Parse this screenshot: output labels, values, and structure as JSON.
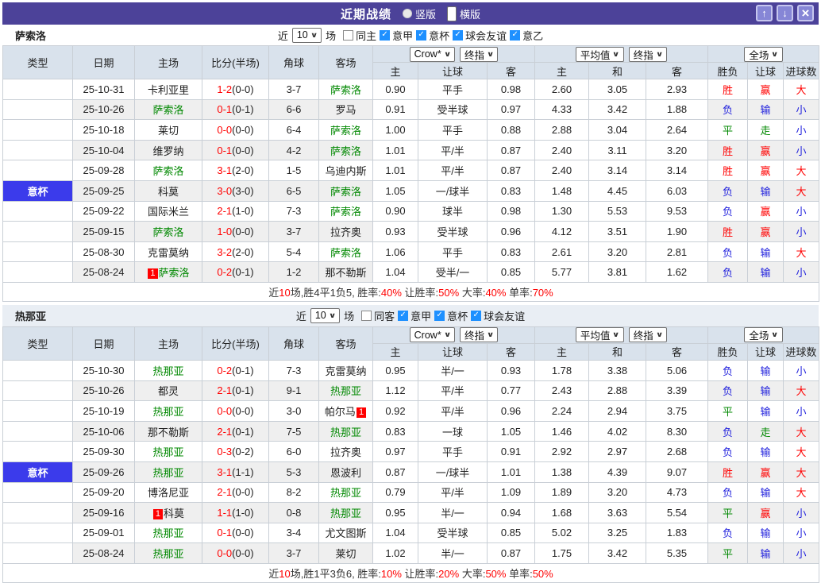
{
  "titlebar": {
    "title": "近期战绩",
    "radios": [
      {
        "label": "竖版",
        "selected": false
      },
      {
        "label": "横版",
        "selected": true
      }
    ],
    "buttons": {
      "up": "↑",
      "down": "↓",
      "close": "×"
    }
  },
  "colors": {
    "titlebar": "#4C4299",
    "button": "#8686D6",
    "buttonborder": "#C6C6EE",
    "league": "#2095FF",
    "cup": "#3B3BEB",
    "headerbg": "#D9E2EC",
    "bandbg": "#E9EEF4",
    "cream": "#FCF6E9",
    "avgblue": "#E7F2F9",
    "stripe": "#EFEFEF",
    "red": "#FF0000",
    "blue": "#2222DD",
    "green": "#008800",
    "teamgreen": "#008800"
  },
  "header": {
    "cols": [
      "类型",
      "日期",
      "主场",
      "比分(半场)",
      "角球",
      "客场"
    ],
    "sel_crow": "Crow*",
    "sel_final1": "终指",
    "sel_avg": "平均值",
    "sel_final2": "终指",
    "sel_full": "全场",
    "g1cols": [
      "主",
      "让球",
      "客"
    ],
    "g2cols": [
      "主",
      "和",
      "客"
    ],
    "g3cols": [
      "胜负",
      "让球",
      "进球数"
    ]
  },
  "sections": [
    {
      "team": "萨索洛",
      "filter": {
        "prefix": "近",
        "count": "10",
        "suffix": "场",
        "checkboxes": [
          {
            "label": "同主",
            "checked": false
          },
          {
            "label": "意甲",
            "checked": true
          },
          {
            "label": "意杯",
            "checked": true
          },
          {
            "label": "球会友谊",
            "checked": true
          },
          {
            "label": "意乙",
            "checked": true
          }
        ]
      },
      "rows": [
        {
          "lg": "意甲",
          "cup": false,
          "date": "25-10-31",
          "home": {
            "n": "卡利亚里"
          },
          "score": [
            "1-2",
            "(0-0)"
          ],
          "cr": "3-7",
          "away": {
            "n": "萨索洛",
            "s": 1
          },
          "o1": [
            "0.90",
            "平手",
            "0.98"
          ],
          "o2": [
            "2.60",
            "3.05",
            "2.93"
          ],
          "res": [
            [
              "胜",
              "r"
            ],
            [
              "赢",
              "r"
            ],
            [
              "大",
              "r"
            ]
          ]
        },
        {
          "lg": "意甲",
          "cup": false,
          "date": "25-10-26",
          "home": {
            "n": "萨索洛",
            "s": 1
          },
          "score": [
            "0-1",
            "(0-1)"
          ],
          "cr": "6-6",
          "away": {
            "n": "罗马"
          },
          "o1": [
            "0.91",
            "受半球",
            "0.97"
          ],
          "o2": [
            "4.33",
            "3.42",
            "1.88"
          ],
          "res": [
            [
              "负",
              "b"
            ],
            [
              "输",
              "b"
            ],
            [
              "小",
              "b"
            ]
          ]
        },
        {
          "lg": "意甲",
          "cup": false,
          "date": "25-10-18",
          "home": {
            "n": "莱切"
          },
          "score": [
            "0-0",
            "(0-0)"
          ],
          "cr": "6-4",
          "away": {
            "n": "萨索洛",
            "s": 1
          },
          "o1": [
            "1.00",
            "平手",
            "0.88"
          ],
          "o2": [
            "2.88",
            "3.04",
            "2.64"
          ],
          "res": [
            [
              "平",
              "g"
            ],
            [
              "走",
              "g"
            ],
            [
              "小",
              "b"
            ]
          ]
        },
        {
          "lg": "意甲",
          "cup": false,
          "date": "25-10-04",
          "home": {
            "n": "维罗纳"
          },
          "score": [
            "0-1",
            "(0-0)"
          ],
          "cr": "4-2",
          "away": {
            "n": "萨索洛",
            "s": 1
          },
          "o1": [
            "1.01",
            "平/半",
            "0.87"
          ],
          "o2": [
            "2.40",
            "3.11",
            "3.20"
          ],
          "res": [
            [
              "胜",
              "r"
            ],
            [
              "赢",
              "r"
            ],
            [
              "小",
              "b"
            ]
          ]
        },
        {
          "lg": "意甲",
          "cup": false,
          "date": "25-09-28",
          "home": {
            "n": "萨索洛",
            "s": 1
          },
          "score": [
            "3-1",
            "(2-0)"
          ],
          "cr": "1-5",
          "away": {
            "n": "乌迪内斯"
          },
          "o1": [
            "1.01",
            "平/半",
            "0.87"
          ],
          "o2": [
            "2.40",
            "3.14",
            "3.14"
          ],
          "res": [
            [
              "胜",
              "r"
            ],
            [
              "赢",
              "r"
            ],
            [
              "大",
              "r"
            ]
          ]
        },
        {
          "lg": "意杯",
          "cup": true,
          "date": "25-09-25",
          "home": {
            "n": "科莫"
          },
          "score": [
            "3-0",
            "(3-0)"
          ],
          "cr": "6-5",
          "away": {
            "n": "萨索洛",
            "s": 1
          },
          "o1": [
            "1.05",
            "一/球半",
            "0.83"
          ],
          "o2": [
            "1.48",
            "4.45",
            "6.03"
          ],
          "res": [
            [
              "负",
              "b"
            ],
            [
              "输",
              "b"
            ],
            [
              "大",
              "r"
            ]
          ]
        },
        {
          "lg": "意甲",
          "cup": false,
          "date": "25-09-22",
          "home": {
            "n": "国际米兰"
          },
          "score": [
            "2-1",
            "(1-0)"
          ],
          "cr": "7-3",
          "away": {
            "n": "萨索洛",
            "s": 1
          },
          "o1": [
            "0.90",
            "球半",
            "0.98"
          ],
          "o2": [
            "1.30",
            "5.53",
            "9.53"
          ],
          "res": [
            [
              "负",
              "b"
            ],
            [
              "赢",
              "r"
            ],
            [
              "小",
              "b"
            ]
          ]
        },
        {
          "lg": "意甲",
          "cup": false,
          "date": "25-09-15",
          "home": {
            "n": "萨索洛",
            "s": 1
          },
          "score": [
            "1-0",
            "(0-0)"
          ],
          "cr": "3-7",
          "away": {
            "n": "拉齐奥"
          },
          "o1": [
            "0.93",
            "受半球",
            "0.96"
          ],
          "o2": [
            "4.12",
            "3.51",
            "1.90"
          ],
          "res": [
            [
              "胜",
              "r"
            ],
            [
              "赢",
              "r"
            ],
            [
              "小",
              "b"
            ]
          ]
        },
        {
          "lg": "意甲",
          "cup": false,
          "date": "25-08-30",
          "home": {
            "n": "克雷莫纳"
          },
          "score": [
            "3-2",
            "(2-0)"
          ],
          "cr": "5-4",
          "away": {
            "n": "萨索洛",
            "s": 1
          },
          "o1": [
            "1.06",
            "平手",
            "0.83"
          ],
          "o2": [
            "2.61",
            "3.20",
            "2.81"
          ],
          "res": [
            [
              "负",
              "b"
            ],
            [
              "输",
              "b"
            ],
            [
              "大",
              "r"
            ]
          ]
        },
        {
          "lg": "意甲",
          "cup": false,
          "date": "25-08-24",
          "home": {
            "n": "萨索洛",
            "s": 1,
            "b": "1",
            "bp": "before"
          },
          "score": [
            "0-2",
            "(0-1)"
          ],
          "cr": "1-2",
          "away": {
            "n": "那不勒斯"
          },
          "o1": [
            "1.04",
            "受半/一",
            "0.85"
          ],
          "o2": [
            "5.77",
            "3.81",
            "1.62"
          ],
          "res": [
            [
              "负",
              "b"
            ],
            [
              "输",
              "b"
            ],
            [
              "小",
              "b"
            ]
          ]
        }
      ],
      "summary": [
        {
          "text": "近"
        },
        {
          "text": "10",
          "red": true
        },
        {
          "text": "场,胜4平1负5, 胜率:"
        },
        {
          "text": "40%",
          "red": true
        },
        {
          "text": " 让胜率:"
        },
        {
          "text": "50%",
          "red": true
        },
        {
          "text": " 大率:"
        },
        {
          "text": "40%",
          "red": true
        },
        {
          "text": " 单率:"
        },
        {
          "text": "70%",
          "red": true
        }
      ]
    },
    {
      "team": "热那亚",
      "filter": {
        "prefix": "近",
        "count": "10",
        "suffix": "场",
        "checkboxes": [
          {
            "label": "同客",
            "checked": false
          },
          {
            "label": "意甲",
            "checked": true
          },
          {
            "label": "意杯",
            "checked": true
          },
          {
            "label": "球会友谊",
            "checked": true
          }
        ]
      },
      "rows": [
        {
          "lg": "意甲",
          "cup": false,
          "date": "25-10-30",
          "home": {
            "n": "热那亚",
            "s": 1
          },
          "score": [
            "0-2",
            "(0-1)"
          ],
          "cr": "7-3",
          "away": {
            "n": "克雷莫纳"
          },
          "o1": [
            "0.95",
            "半/一",
            "0.93"
          ],
          "o2": [
            "1.78",
            "3.38",
            "5.06"
          ],
          "res": [
            [
              "负",
              "b"
            ],
            [
              "输",
              "b"
            ],
            [
              "小",
              "b"
            ]
          ]
        },
        {
          "lg": "意甲",
          "cup": false,
          "date": "25-10-26",
          "home": {
            "n": "都灵"
          },
          "score": [
            "2-1",
            "(0-1)"
          ],
          "cr": "9-1",
          "away": {
            "n": "热那亚",
            "s": 1
          },
          "o1": [
            "1.12",
            "平/半",
            "0.77"
          ],
          "o2": [
            "2.43",
            "2.88",
            "3.39"
          ],
          "res": [
            [
              "负",
              "b"
            ],
            [
              "输",
              "b"
            ],
            [
              "大",
              "r"
            ]
          ]
        },
        {
          "lg": "意甲",
          "cup": false,
          "date": "25-10-19",
          "home": {
            "n": "热那亚",
            "s": 1
          },
          "score": [
            "0-0",
            "(0-0)"
          ],
          "cr": "3-0",
          "away": {
            "n": "帕尔马",
            "b": "1",
            "bp": "after"
          },
          "o1": [
            "0.92",
            "平/半",
            "0.96"
          ],
          "o2": [
            "2.24",
            "2.94",
            "3.75"
          ],
          "res": [
            [
              "平",
              "g"
            ],
            [
              "输",
              "b"
            ],
            [
              "小",
              "b"
            ]
          ]
        },
        {
          "lg": "意甲",
          "cup": false,
          "date": "25-10-06",
          "home": {
            "n": "那不勒斯"
          },
          "score": [
            "2-1",
            "(0-1)"
          ],
          "cr": "7-5",
          "away": {
            "n": "热那亚",
            "s": 1
          },
          "o1": [
            "0.83",
            "一球",
            "1.05"
          ],
          "o2": [
            "1.46",
            "4.02",
            "8.30"
          ],
          "res": [
            [
              "负",
              "b"
            ],
            [
              "走",
              "g"
            ],
            [
              "大",
              "r"
            ]
          ]
        },
        {
          "lg": "意甲",
          "cup": false,
          "date": "25-09-30",
          "home": {
            "n": "热那亚",
            "s": 1
          },
          "score": [
            "0-3",
            "(0-2)"
          ],
          "cr": "6-0",
          "away": {
            "n": "拉齐奥"
          },
          "o1": [
            "0.97",
            "平手",
            "0.91"
          ],
          "o2": [
            "2.92",
            "2.97",
            "2.68"
          ],
          "res": [
            [
              "负",
              "b"
            ],
            [
              "输",
              "b"
            ],
            [
              "大",
              "r"
            ]
          ]
        },
        {
          "lg": "意杯",
          "cup": true,
          "date": "25-09-26",
          "home": {
            "n": "热那亚",
            "s": 1
          },
          "score": [
            "3-1",
            "(1-1)"
          ],
          "cr": "5-3",
          "away": {
            "n": "恩波利"
          },
          "o1": [
            "0.87",
            "一/球半",
            "1.01"
          ],
          "o2": [
            "1.38",
            "4.39",
            "9.07"
          ],
          "res": [
            [
              "胜",
              "r"
            ],
            [
              "赢",
              "r"
            ],
            [
              "大",
              "r"
            ]
          ]
        },
        {
          "lg": "意甲",
          "cup": false,
          "date": "25-09-20",
          "home": {
            "n": "博洛尼亚"
          },
          "score": [
            "2-1",
            "(0-0)"
          ],
          "cr": "8-2",
          "away": {
            "n": "热那亚",
            "s": 1
          },
          "o1": [
            "0.79",
            "平/半",
            "1.09"
          ],
          "o2": [
            "1.89",
            "3.20",
            "4.73"
          ],
          "res": [
            [
              "负",
              "b"
            ],
            [
              "输",
              "b"
            ],
            [
              "大",
              "r"
            ]
          ]
        },
        {
          "lg": "意甲",
          "cup": false,
          "date": "25-09-16",
          "home": {
            "n": "科莫",
            "b": "1",
            "bp": "before"
          },
          "score": [
            "1-1",
            "(1-0)"
          ],
          "cr": "0-8",
          "away": {
            "n": "热那亚",
            "s": 1
          },
          "o1": [
            "0.95",
            "半/一",
            "0.94"
          ],
          "o2": [
            "1.68",
            "3.63",
            "5.54"
          ],
          "res": [
            [
              "平",
              "g"
            ],
            [
              "赢",
              "r"
            ],
            [
              "小",
              "b"
            ]
          ]
        },
        {
          "lg": "意甲",
          "cup": false,
          "date": "25-09-01",
          "home": {
            "n": "热那亚",
            "s": 1
          },
          "score": [
            "0-1",
            "(0-0)"
          ],
          "cr": "3-4",
          "away": {
            "n": "尤文图斯"
          },
          "o1": [
            "1.04",
            "受半球",
            "0.85"
          ],
          "o2": [
            "5.02",
            "3.25",
            "1.83"
          ],
          "res": [
            [
              "负",
              "b"
            ],
            [
              "输",
              "b"
            ],
            [
              "小",
              "b"
            ]
          ]
        },
        {
          "lg": "意甲",
          "cup": false,
          "date": "25-08-24",
          "home": {
            "n": "热那亚",
            "s": 1
          },
          "score": [
            "0-0",
            "(0-0)"
          ],
          "cr": "3-7",
          "away": {
            "n": "莱切"
          },
          "o1": [
            "1.02",
            "半/一",
            "0.87"
          ],
          "o2": [
            "1.75",
            "3.42",
            "5.35"
          ],
          "res": [
            [
              "平",
              "g"
            ],
            [
              "输",
              "b"
            ],
            [
              "小",
              "b"
            ]
          ]
        }
      ],
      "summary": [
        {
          "text": "近"
        },
        {
          "text": "10",
          "red": true
        },
        {
          "text": "场,胜1平3负6, 胜率:"
        },
        {
          "text": "10%",
          "red": true
        },
        {
          "text": " 让胜率:"
        },
        {
          "text": "20%",
          "red": true
        },
        {
          "text": " 大率:"
        },
        {
          "text": "50%",
          "red": true
        },
        {
          "text": " 单率:"
        },
        {
          "text": "50%",
          "red": true
        }
      ]
    }
  ]
}
